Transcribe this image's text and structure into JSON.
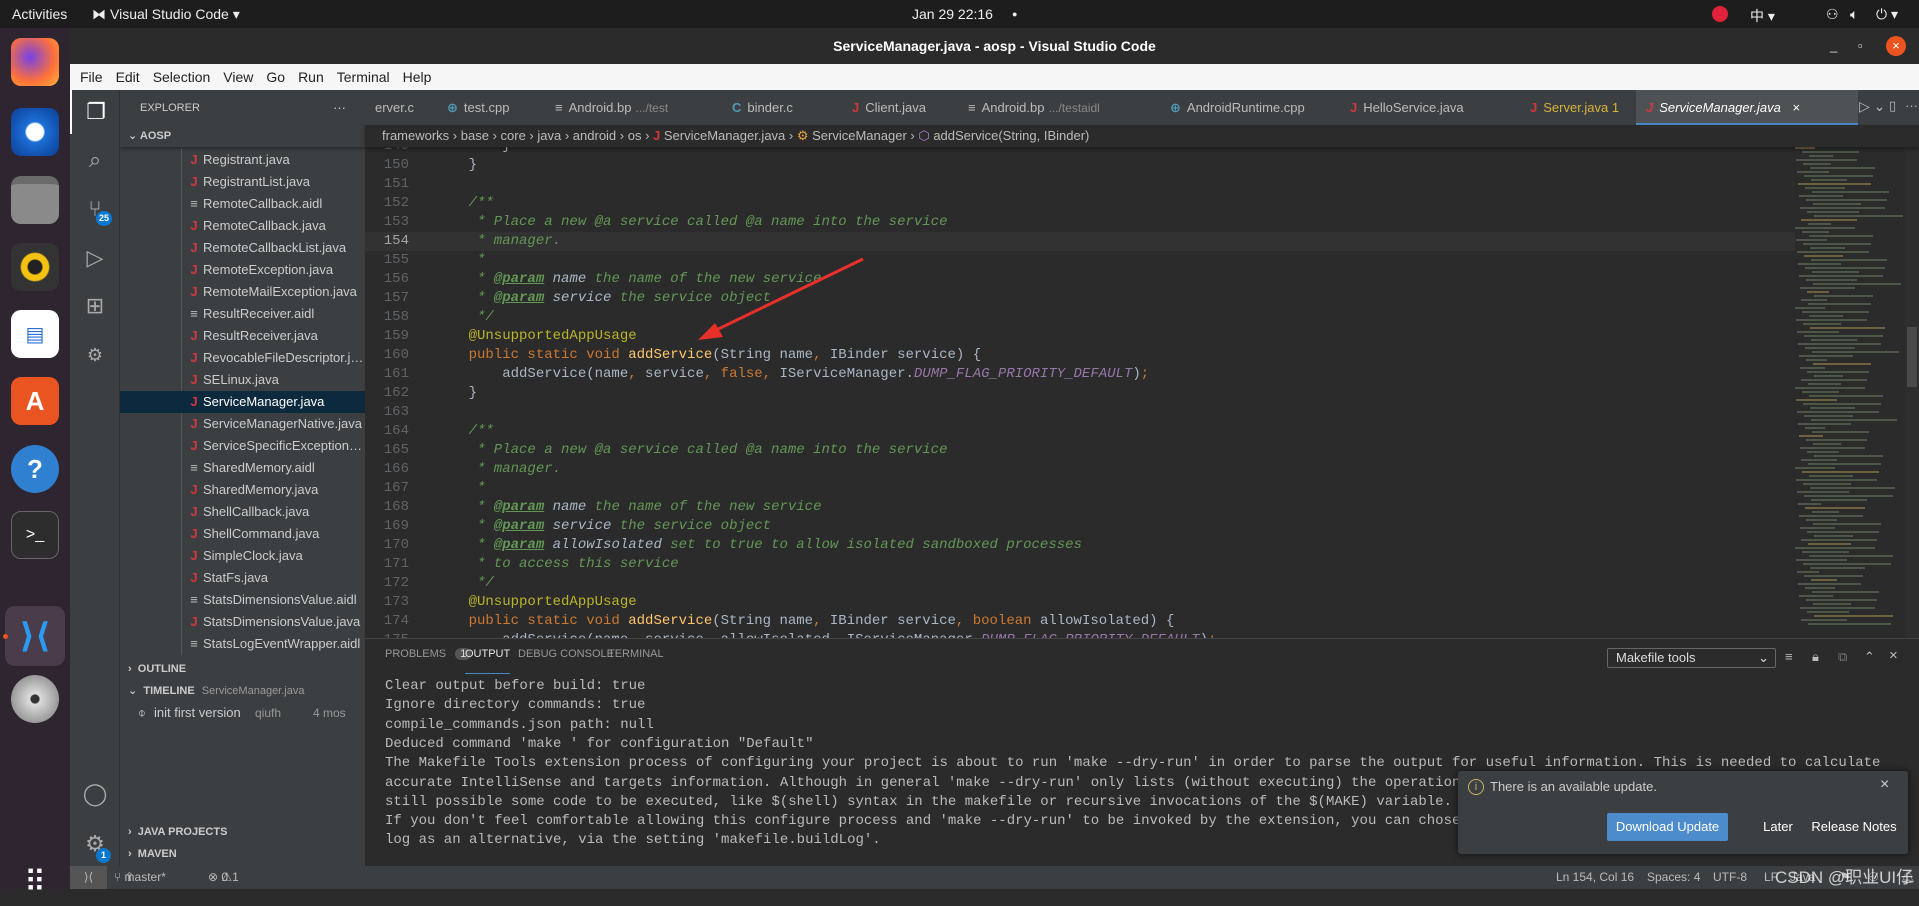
{
  "topbar": {
    "activities": "Activities",
    "app_menu": "Visual Studio Code ▾",
    "clock": "Jan 29  22:16",
    "input_method": "中 ▾"
  },
  "dock": [
    "firefox",
    "thunderbird",
    "files",
    "rhythmbox",
    "libreoffice-writer",
    "ubuntu-software",
    "help",
    "terminal",
    "visual-studio-code",
    "dvd",
    "show-applications"
  ],
  "window": {
    "title": "ServiceManager.java - aosp - Visual Studio Code"
  },
  "menu": [
    "File",
    "Edit",
    "Selection",
    "View",
    "Go",
    "Run",
    "Terminal",
    "Help"
  ],
  "activity": {
    "scm_badge": "25",
    "settings_badge": "1"
  },
  "sidebar": {
    "title": "EXPLORER",
    "more": "···",
    "root": "AOSP",
    "files": [
      {
        "name": "Registrant.java",
        "type": "java"
      },
      {
        "name": "RegistrantList.java",
        "type": "java"
      },
      {
        "name": "RemoteCallback.aidl",
        "type": "aidl"
      },
      {
        "name": "RemoteCallback.java",
        "type": "java"
      },
      {
        "name": "RemoteCallbackList.java",
        "type": "java"
      },
      {
        "name": "RemoteException.java",
        "type": "java"
      },
      {
        "name": "RemoteMailException.java",
        "type": "java"
      },
      {
        "name": "ResultReceiver.aidl",
        "type": "aidl"
      },
      {
        "name": "ResultReceiver.java",
        "type": "java"
      },
      {
        "name": "RevocableFileDescriptor.java",
        "type": "java"
      },
      {
        "name": "SELinux.java",
        "type": "java"
      },
      {
        "name": "ServiceManager.java",
        "type": "java",
        "selected": true
      },
      {
        "name": "ServiceManagerNative.java",
        "type": "java"
      },
      {
        "name": "ServiceSpecificException.java",
        "type": "java"
      },
      {
        "name": "SharedMemory.aidl",
        "type": "aidl"
      },
      {
        "name": "SharedMemory.java",
        "type": "java"
      },
      {
        "name": "ShellCallback.java",
        "type": "java"
      },
      {
        "name": "ShellCommand.java",
        "type": "java"
      },
      {
        "name": "SimpleClock.java",
        "type": "java"
      },
      {
        "name": "StatFs.java",
        "type": "java"
      },
      {
        "name": "StatsDimensionsValue.aidl",
        "type": "aidl"
      },
      {
        "name": "StatsDimensionsValue.java",
        "type": "java"
      },
      {
        "name": "StatsLogEventWrapper.aidl",
        "type": "aidl"
      }
    ],
    "outline": "OUTLINE",
    "timeline": "TIMELINE",
    "timeline_file": "ServiceManager.java",
    "timeline_entry": {
      "message": "init first version",
      "author": "qiufh",
      "age": "4 mos"
    },
    "java_projects": "JAVA PROJECTS",
    "maven": "MAVEN"
  },
  "tabs": [
    {
      "icon": "",
      "label": "erver.c",
      "desc": ""
    },
    {
      "icon": "C++",
      "label": "test.cpp",
      "desc": ""
    },
    {
      "icon": "≡",
      "label": "Android.bp",
      "desc": ".../test"
    },
    {
      "icon": "C",
      "label": "binder.c",
      "desc": ""
    },
    {
      "icon": "J",
      "label": "Client.java",
      "desc": ""
    },
    {
      "icon": "≡",
      "label": "Android.bp",
      "desc": ".../testaidl"
    },
    {
      "icon": "C++",
      "label": "AndroidRuntime.cpp",
      "desc": ""
    },
    {
      "icon": "J",
      "label": "HelloService.java",
      "desc": ""
    },
    {
      "icon": "J",
      "label": "Server.java 1",
      "desc": "",
      "warning": true
    },
    {
      "icon": "J",
      "label": "ServiceManager.java",
      "desc": "",
      "active": true
    }
  ],
  "breadcrumbs": [
    "frameworks",
    "base",
    "core",
    "java",
    "android",
    "os",
    "ServiceManager.java",
    "ServiceManager",
    "addService(String, IBinder)"
  ],
  "editor": {
    "current_line": 154,
    "lines": [
      {
        "n": 149,
        "t": [
          [
            "",
            "        }"
          ]
        ]
      },
      {
        "n": 150,
        "t": [
          [
            "",
            "    }"
          ]
        ]
      },
      {
        "n": 151,
        "t": []
      },
      {
        "n": 152,
        "t": [
          [
            "cm",
            "    /**"
          ]
        ]
      },
      {
        "n": 153,
        "t": [
          [
            "cm",
            "     * Place a new @a service called @a name into the service"
          ]
        ]
      },
      {
        "n": 154,
        "t": [
          [
            "cm",
            "     * manager."
          ]
        ]
      },
      {
        "n": 155,
        "t": [
          [
            "cm",
            "     *"
          ]
        ]
      },
      {
        "n": 156,
        "t": [
          [
            "cm",
            "     * "
          ],
          [
            "tg",
            "@param"
          ],
          [
            "pn",
            " name"
          ],
          [
            "cm",
            " the name of the new service"
          ]
        ]
      },
      {
        "n": 157,
        "t": [
          [
            "cm",
            "     * "
          ],
          [
            "tg",
            "@param"
          ],
          [
            "pn",
            " service"
          ],
          [
            "cm",
            " the service object"
          ]
        ]
      },
      {
        "n": 158,
        "t": [
          [
            "cm",
            "     */"
          ]
        ]
      },
      {
        "n": 159,
        "t": [
          [
            "an",
            "    @UnsupportedAppUsage"
          ]
        ]
      },
      {
        "n": 160,
        "t": [
          [
            "kw",
            "    public static void "
          ],
          [
            "fn",
            "addService"
          ],
          [
            "",
            "(String name"
          ],
          [
            "kw",
            ", "
          ],
          [
            "",
            "IBinder service) {"
          ]
        ]
      },
      {
        "n": 161,
        "t": [
          [
            "",
            "        addService(name"
          ],
          [
            "kw",
            ", "
          ],
          [
            "",
            "service"
          ],
          [
            "kw",
            ", false, "
          ],
          [
            "",
            "IServiceManager."
          ],
          [
            "cn",
            "DUMP_FLAG_PRIORITY_DEFAULT"
          ],
          [
            "",
            ")"
          ],
          [
            "kw",
            ";"
          ]
        ]
      },
      {
        "n": 162,
        "t": [
          [
            "",
            "    }"
          ]
        ]
      },
      {
        "n": 163,
        "t": []
      },
      {
        "n": 164,
        "t": [
          [
            "cm",
            "    /**"
          ]
        ]
      },
      {
        "n": 165,
        "t": [
          [
            "cm",
            "     * Place a new @a service called @a name into the service"
          ]
        ]
      },
      {
        "n": 166,
        "t": [
          [
            "cm",
            "     * manager."
          ]
        ]
      },
      {
        "n": 167,
        "t": [
          [
            "cm",
            "     *"
          ]
        ]
      },
      {
        "n": 168,
        "t": [
          [
            "cm",
            "     * "
          ],
          [
            "tg",
            "@param"
          ],
          [
            "pn",
            " name"
          ],
          [
            "cm",
            " the name of the new service"
          ]
        ]
      },
      {
        "n": 169,
        "t": [
          [
            "cm",
            "     * "
          ],
          [
            "tg",
            "@param"
          ],
          [
            "pn",
            " service"
          ],
          [
            "cm",
            " the service object"
          ]
        ]
      },
      {
        "n": 170,
        "t": [
          [
            "cm",
            "     * "
          ],
          [
            "tg",
            "@param"
          ],
          [
            "pn",
            " allowIsolated"
          ],
          [
            "cm",
            " set to true to allow isolated sandboxed processes"
          ]
        ]
      },
      {
        "n": 171,
        "t": [
          [
            "cm",
            "     * to access this service"
          ]
        ]
      },
      {
        "n": 172,
        "t": [
          [
            "cm",
            "     */"
          ]
        ]
      },
      {
        "n": 173,
        "t": [
          [
            "an",
            "    @UnsupportedAppUsage"
          ]
        ]
      },
      {
        "n": 174,
        "t": [
          [
            "kw",
            "    public static void "
          ],
          [
            "fn",
            "addService"
          ],
          [
            "",
            "(String name"
          ],
          [
            "kw",
            ", "
          ],
          [
            "",
            "IBinder service"
          ],
          [
            "kw",
            ", boolean "
          ],
          [
            "",
            "allowIsolated) {"
          ]
        ]
      },
      {
        "n": 175,
        "t": [
          [
            "",
            "        addService(name"
          ],
          [
            "kw",
            ", "
          ],
          [
            "",
            "service"
          ],
          [
            "kw",
            ", "
          ],
          [
            "",
            "allowIsolated"
          ],
          [
            "kw",
            ", "
          ],
          [
            "",
            "IServiceManager."
          ],
          [
            "cn",
            "DUMP_FLAG_PRIORITY_DEFAULT"
          ],
          [
            "",
            ")"
          ],
          [
            "kw",
            ";"
          ]
        ]
      }
    ]
  },
  "panel": {
    "tabs": [
      {
        "label": "PROBLEMS",
        "count": "1"
      },
      {
        "label": "OUTPUT",
        "active": true
      },
      {
        "label": "DEBUG CONSOLE"
      },
      {
        "label": "TERMINAL"
      }
    ],
    "channel": "Makefile tools",
    "output": [
      "Clear output before build: true",
      "Ignore directory commands: true",
      "compile_commands.json path: null",
      "Deduced command 'make ' for configuration \"Default\"",
      "The Makefile Tools extension process of configuring your project is about to run 'make --dry-run' in order to parse the output for useful information. This is needed to calculate",
      "accurate IntelliSense and targets information. Although in general 'make --dry-run' only lists (without executing) the operations",
      "still possible some code to be executed, like $(shell) syntax in the makefile or recursive invocations of the $(MAKE) variable.",
      "If you don't feel comfortable allowing this configure process and 'make --dry-run' to be invoked by the extension, you can chose",
      "log as an alternative, via the setting 'makefile.buildLog'."
    ]
  },
  "notification": {
    "message": "There is an available update.",
    "download": "Download Update",
    "later": "Later",
    "release_notes": "Release Notes"
  },
  "status": {
    "branch": "master*",
    "errors": "0",
    "warnings": "1",
    "position": "Ln 154, Col 16",
    "spaces": "Spaces: 4",
    "encoding": "UTF-8",
    "eol": "LF",
    "language": "Java"
  },
  "watermark": "CSDN @职业UI仔",
  "colors": {
    "accent": "#4a88c7",
    "button": "#4d8ccc",
    "arrow": "#e8302a",
    "badge": "#0b78d0"
  }
}
